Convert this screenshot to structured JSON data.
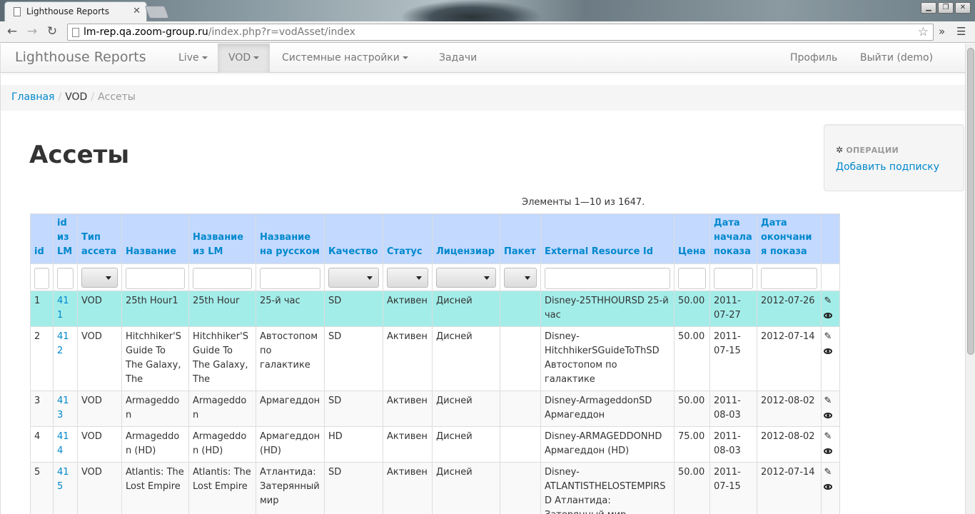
{
  "browser": {
    "tab_title": "Lighthouse Reports",
    "url_host": "lm-rep.qa.zoom-group.ru",
    "url_path": "/index.php?r=vodAsset/index"
  },
  "navbar": {
    "brand": "Lighthouse Reports",
    "items": [
      {
        "label": "Live",
        "dropdown": true
      },
      {
        "label": "VOD",
        "dropdown": true,
        "active": true
      },
      {
        "label": "Системные настройки",
        "dropdown": true
      },
      {
        "label": "Задачи",
        "dropdown": false
      }
    ],
    "right_items": [
      {
        "label": "Профиль"
      },
      {
        "label": "Выйти (demo)"
      }
    ]
  },
  "breadcrumb": {
    "home": "Главная",
    "section": "VOD",
    "current": "Ассеты"
  },
  "page": {
    "title": "Ассеты",
    "summary": "Элементы 1—10 из 1647."
  },
  "operations": {
    "header": "ОПЕРАЦИИ",
    "link": "Добавить подписку"
  },
  "table": {
    "columns": [
      "id",
      "id из LM",
      "Тип ассета",
      "Название",
      "Название из LM",
      "Название на русском",
      "Качество",
      "Статус",
      "Лицензиар",
      "Пакет",
      "External Resource Id",
      "Цена",
      "Дата начала показа",
      "Дата окончания показа"
    ],
    "rows": [
      {
        "id": "1",
        "lm": "411",
        "type": "VOD",
        "name": "25th Hour1",
        "name_lm": "25th Hour",
        "name_ru": "25-й час",
        "quality": "SD",
        "status": "Активен",
        "licensor": "Дисней",
        "package": "",
        "ext_id": "Disney-25THHOURSD 25-й час",
        "price": "50.00",
        "start": "2011-07-27",
        "end": "2012-07-26"
      },
      {
        "id": "2",
        "lm": "412",
        "type": "VOD",
        "name": "Hitchhiker'S Guide To The Galaxy, The",
        "name_lm": "Hitchhiker'S Guide To The Galaxy, The",
        "name_ru": "Автостопом по галактике",
        "quality": "SD",
        "status": "Активен",
        "licensor": "Дисней",
        "package": "",
        "ext_id": "Disney-HitchhikerSGuideToThSD Автостопом по галактике",
        "price": "50.00",
        "start": "2011-07-15",
        "end": "2012-07-14"
      },
      {
        "id": "3",
        "lm": "413",
        "type": "VOD",
        "name": "Armageddon",
        "name_lm": "Armageddon",
        "name_ru": "Армагеддон",
        "quality": "SD",
        "status": "Активен",
        "licensor": "Дисней",
        "package": "",
        "ext_id": "Disney-ArmageddonSD Армагеддон",
        "price": "50.00",
        "start": "2011-08-03",
        "end": "2012-08-02"
      },
      {
        "id": "4",
        "lm": "414",
        "type": "VOD",
        "name": "Armageddon (HD)",
        "name_lm": "Armageddon (HD)",
        "name_ru": "Армагеддон (HD)",
        "quality": "HD",
        "status": "Активен",
        "licensor": "Дисней",
        "package": "",
        "ext_id": "Disney-ARMAGEDDONHD Армагеддон (HD)",
        "price": "75.00",
        "start": "2011-08-03",
        "end": "2012-08-02"
      },
      {
        "id": "5",
        "lm": "415",
        "type": "VOD",
        "name": "Atlantis: The Lost Empire",
        "name_lm": "Atlantis: The Lost Empire",
        "name_ru": "Атлантида: Затерянный мир",
        "quality": "SD",
        "status": "Активен",
        "licensor": "Дисней",
        "package": "",
        "ext_id": "Disney-ATLANTISTHELOSTEMPIRSD Атлантида: Затерянный мир",
        "price": "50.00",
        "start": "2011-07-15",
        "end": "2012-07-14"
      }
    ]
  },
  "colors": {
    "link": "#0088cc",
    "header_bg": "#c3d9ff",
    "selected_row": "#a3ede9"
  }
}
